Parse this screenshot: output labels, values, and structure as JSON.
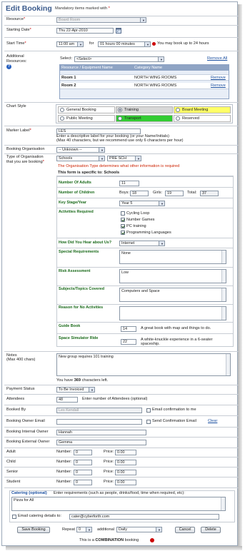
{
  "header": {
    "title": "Edit Booking",
    "mandatory_note": "Mandatory items marked with ",
    "mandatory_star": "*"
  },
  "resource": {
    "label": "Resource",
    "value": "Board Room"
  },
  "starting_date": {
    "label": "Starting Date",
    "value": "Thu 22-Apr-2010"
  },
  "start_time": {
    "label": "Start Time",
    "time": "11:00 am",
    "for_word": "for",
    "duration": "01 hours 00 minutes",
    "note": "You may book up to 24 hours"
  },
  "additional_resources": {
    "label_line1": "Additional",
    "label_line2": "Resources:",
    "select_label": "Select:",
    "select_value": "<Select>",
    "remove_all": "Remove All",
    "columns": [
      "Resource / Equipment Name",
      "Category Name"
    ],
    "rows": [
      {
        "name": "Room 1",
        "category": "NORTH WING ROOMS",
        "action": "Remove"
      },
      {
        "name": "Room 2",
        "category": "NORTH WING ROOMS",
        "action": "Remove"
      }
    ]
  },
  "chart_style": {
    "label": "Chart Style",
    "options": [
      {
        "label": "General Booking",
        "color": "#ffffff",
        "checked": false
      },
      {
        "label": "Training",
        "color": "#d8d8d8",
        "checked": true
      },
      {
        "label": "Board Meeting",
        "color": "#ffff66",
        "checked": false
      },
      {
        "label": "Public Meeting",
        "color": "#ffffff",
        "checked": false
      },
      {
        "label": "Transport",
        "color": "#33cc33",
        "checked": false
      },
      {
        "label": "Reserved",
        "color": "#ffffff",
        "checked": false
      }
    ]
  },
  "marker_label": {
    "label": "Marker Label",
    "value": "LES",
    "hint1": "Enter a descriptive label for your booking (or your Name/Initials)",
    "hint2": "(Max 40 characters, but we recommend use only 6 characters per hour)"
  },
  "booking_org": {
    "label": "Booking Organisation",
    "value": "-- Unknown --"
  },
  "org_type": {
    "label_line1": "Type of Organisation",
    "label_line2": "that you are booking",
    "value1": "Schools",
    "value2": "PRE SCH",
    "note": "The Organisation Type determines what other information is required",
    "specific": "This form is specific to: Schools"
  },
  "school_form": {
    "adults_label": "Number Of Adults",
    "adults": "11",
    "children_label": "Number of Children",
    "boys_label": "Boys:",
    "boys": "18",
    "girls_label": "Girls:",
    "girls": "19",
    "total_label": "Total:",
    "total": "37",
    "key_stage_label": "Key Stage/Year",
    "key_stage": "Year 5",
    "activities_label": "Activities Required",
    "activities": [
      {
        "label": "Cycling Loop",
        "checked": false
      },
      {
        "label": "Number Games",
        "checked": true
      },
      {
        "label": "PC training",
        "checked": true
      },
      {
        "label": "Programming Languages",
        "checked": true
      }
    ],
    "hear_label": "How Did You Hear about Us?",
    "hear": "Internet",
    "special_label": "Special Requirements",
    "special": "None",
    "risk_label": "Risk Assessment",
    "risk": "Low",
    "subjects_label": "Subjects/Topics Covered",
    "subjects": "Computers and Space",
    "reason_label": "Reason for No Activities",
    "reason": "",
    "guide_label": "Guide Book",
    "guide_qty": "14",
    "guide_desc": "A great book with map and things to do.",
    "ride_label": "Space Simulator Ride",
    "ride_qty": "22",
    "ride_desc_line1": "A white-knuckle experience in a 6-seater",
    "ride_desc_line2": "spaceship."
  },
  "notes": {
    "label": "Notes",
    "sublabel": "(Max 400 chars)",
    "value": "New group requires 101 training",
    "left_prefix": "You have ",
    "left_count": "369",
    "left_suffix": " characters left."
  },
  "payment_status": {
    "label": "Payment Status",
    "value": "To Be Invoiced"
  },
  "attendees": {
    "label": "Attendees",
    "value": "48",
    "hint": "Enter number of Attendees (optional)"
  },
  "booked_by": {
    "label": "Booked By",
    "value": "Les Kendall",
    "email_confirm": "Email confirmation to me"
  },
  "owner_email": {
    "label": "Booking Owner Email",
    "send_confirm": "Send Confirmation Email",
    "clear": "Clear"
  },
  "internal_owner": {
    "label": "Booking Internal Owner",
    "value": "Hannah"
  },
  "external_owner": {
    "label": "Booking External Owner",
    "value": "Gemma"
  },
  "pricing": {
    "number_label": "Number:",
    "price_label": "Price:",
    "rows": [
      {
        "label": "Adult",
        "number": "0",
        "price": "0.00"
      },
      {
        "label": "Child",
        "number": "0",
        "price": "0.00"
      },
      {
        "label": "Senior",
        "number": "0",
        "price": "0.00"
      },
      {
        "label": "Student",
        "number": "0",
        "price": "0.00"
      }
    ]
  },
  "catering": {
    "label": "Catering (optional)",
    "hint": "Enter requirements (such as people, drinks/food, time when required, etc):",
    "value": "Pizza for All",
    "email_label": "Email catering details to:",
    "email": "cater@cyberforth.com"
  },
  "footer": {
    "save": "Save Booking",
    "repeat_label": "Repeat",
    "repeat_value": "0",
    "additional_label": "additional",
    "freq": "Daily",
    "cancel": "Cancel",
    "delete": "Delete",
    "combination_prefix": "This is a ",
    "combination_word": "COMBINATION",
    "combination_suffix": " booking"
  },
  "colors": {
    "title": "#3a5a8c",
    "required": "#cc0000",
    "link": "#1a4fa0",
    "school_label": "#1b6b1b",
    "grid_header": "#8fa4c4"
  },
  "icons": [
    "calendar-icon",
    "help-icon",
    "info-icon"
  ]
}
